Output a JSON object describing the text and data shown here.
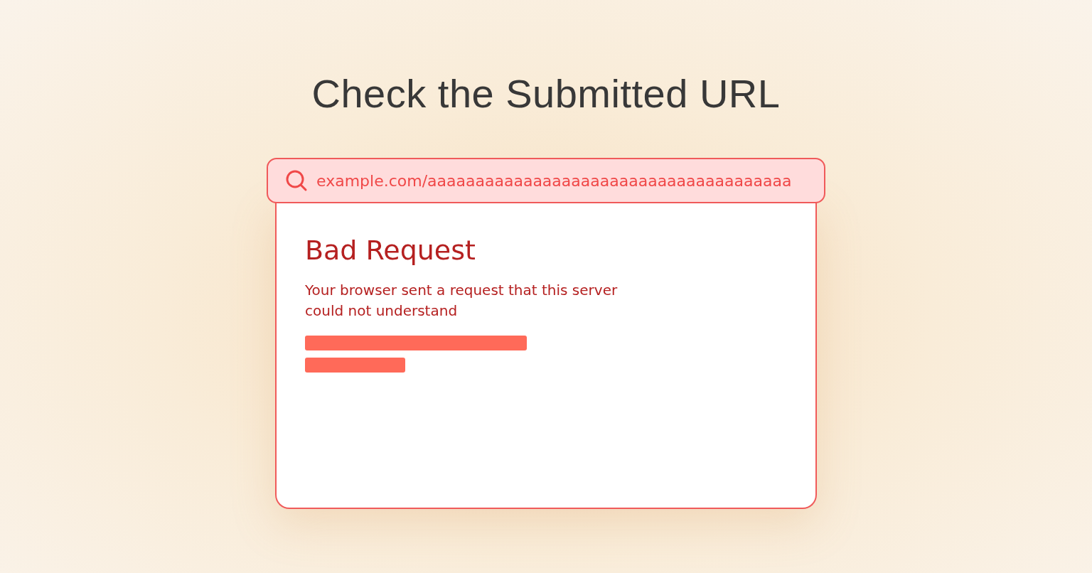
{
  "title": "Check the Submitted URL",
  "address_bar": {
    "value": "example.com/aaaaaaaaaaaaaaaaaaaaaaaaaaaaaaaaaaaaaa"
  },
  "error_page": {
    "heading": "Bad Request",
    "message": "Your browser sent a request that this server could not understand"
  }
}
